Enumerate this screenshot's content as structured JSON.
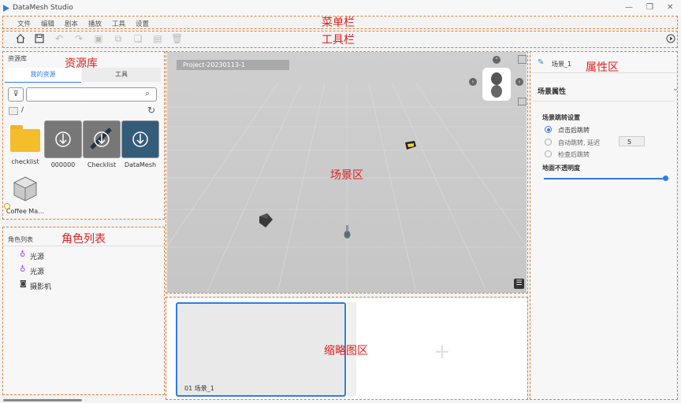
{
  "app": {
    "title": "DataMesh Studio"
  },
  "menu": [
    "文件",
    "编辑",
    "剧本",
    "播放",
    "工具",
    "设置"
  ],
  "annotations": {
    "menubar": "菜单栏",
    "toolbar": "工具栏",
    "asset_library": "资源库",
    "role_list": "角色列表",
    "scene_area": "场景区",
    "thumbnail_area": "缩略图区",
    "property_area": "属性区"
  },
  "assets_panel": {
    "header": "资源库",
    "tabs": [
      "我的资源",
      "工具"
    ],
    "path": "/",
    "items": [
      {
        "label": "checklist",
        "icon": "folder-icon"
      },
      {
        "label": "000000",
        "icon": "download-icon"
      },
      {
        "label": "Checklist",
        "icon": "download-icon"
      },
      {
        "label": "DataMesh",
        "icon": "download-icon"
      },
      {
        "label": "Coffee Ma…",
        "icon": "cube-icon"
      }
    ]
  },
  "roles_panel": {
    "header": "角色列表",
    "items": [
      {
        "label": "光源",
        "icon": "light-bulb-icon"
      },
      {
        "label": "光源",
        "icon": "light-bulb-icon"
      },
      {
        "label": "摄影机",
        "icon": "camera-icon"
      }
    ]
  },
  "scene": {
    "project_name": "Project-20230113-1"
  },
  "thumbnails": {
    "scene_label": "01  场景_1"
  },
  "properties": {
    "scene_name": "场景_1",
    "section_title": "场景属性",
    "jump_settings_title": "场景跳转设置",
    "options": [
      "点击后跳转",
      "自动跳转, 延迟",
      "检查后跳转"
    ],
    "selected_option": 0,
    "delay_value": "5",
    "opacity_label": "地面不透明度",
    "opacity_value": 0.97
  },
  "colors": {
    "accent": "#2f7de1",
    "annotation": "#e02020",
    "dashed_border": "#d9823b"
  }
}
